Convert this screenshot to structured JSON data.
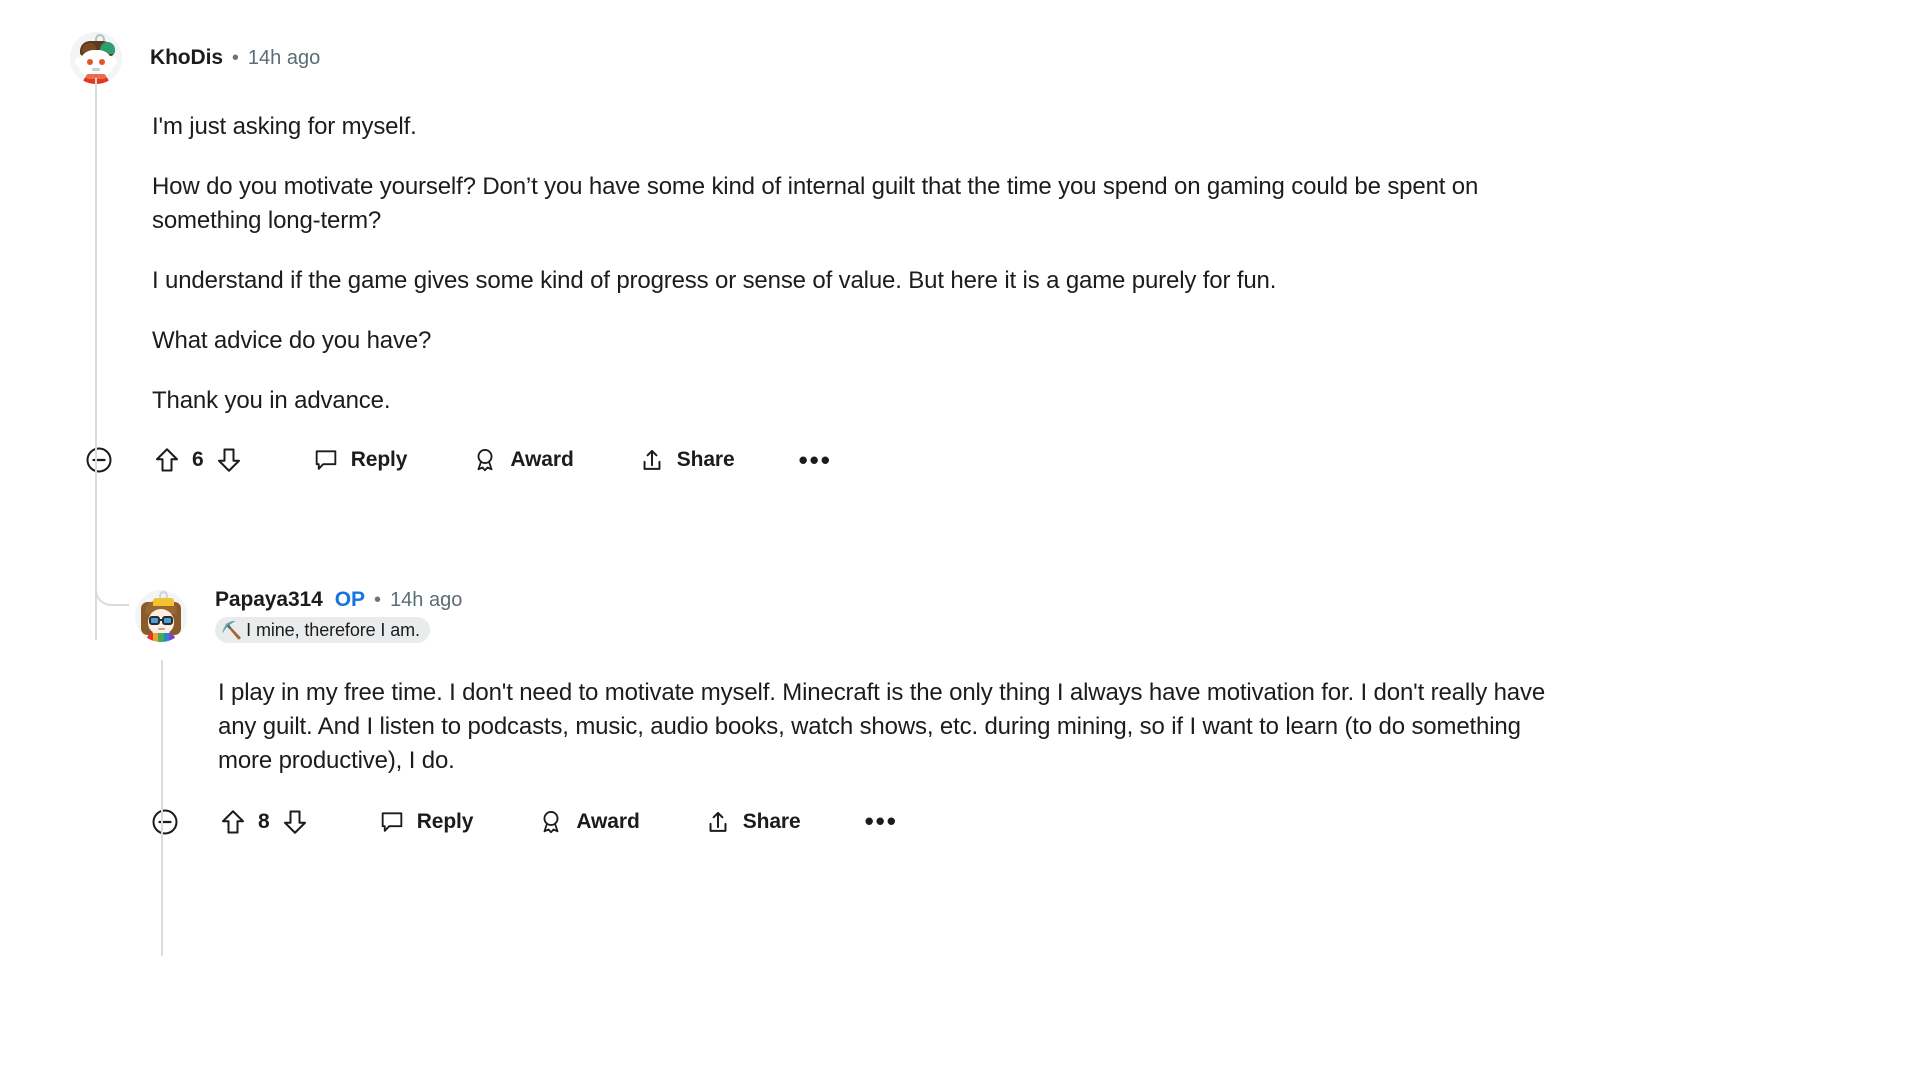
{
  "thread": {
    "comments": [
      {
        "id": "comment-khodis",
        "author": "KhoDis",
        "timestamp": "14h ago",
        "is_op": false,
        "op_label": "",
        "flair": null,
        "avatar_name": "snoo-avatar-khodis",
        "paragraphs": [
          "I'm just asking for myself.",
          "How do you motivate yourself? Don’t you have some kind of internal guilt that the time you spend on gaming could be spent on something long-term?",
          "I understand if the game gives some kind of progress or sense of value. But here it is a game purely for fun.",
          "What advice do you have?",
          "Thank you in advance."
        ],
        "actions": {
          "collapse_icon": "minus-circle-icon",
          "upvote_icon": "upvote-arrow-icon",
          "vote_count": "6",
          "downvote_icon": "downvote-arrow-icon",
          "reply_icon": "comment-bubble-icon",
          "reply_label": "Reply",
          "award_icon": "award-ribbon-icon",
          "award_label": "Award",
          "share_icon": "share-arrow-icon",
          "share_label": "Share",
          "more_label": "•••"
        }
      },
      {
        "id": "comment-papaya314",
        "author": "Papaya314",
        "timestamp": "14h ago",
        "is_op": true,
        "op_label": "OP",
        "flair": {
          "emoji": "⛏️",
          "emoji_name": "pickaxe-emoji",
          "text": "I mine, therefore I am."
        },
        "avatar_name": "snoo-avatar-papaya314",
        "paragraphs": [
          "I play in my free time. I don't need to motivate myself. Minecraft is the only thing I always have motivation for. I don't really have any guilt. And I listen to podcasts, music, audio books, watch shows, etc. during mining, so if I want to learn (to do something more productive), I do."
        ],
        "actions": {
          "collapse_icon": "minus-circle-icon",
          "upvote_icon": "upvote-arrow-icon",
          "vote_count": "8",
          "downvote_icon": "downvote-arrow-icon",
          "reply_icon": "comment-bubble-icon",
          "reply_label": "Reply",
          "award_icon": "award-ribbon-icon",
          "award_label": "Award",
          "share_icon": "share-arrow-icon",
          "share_label": "Share",
          "more_label": "•••"
        }
      }
    ]
  },
  "colors": {
    "text": "#1c1c1c",
    "meta": "#5c6c74",
    "op_blue": "#1874e0",
    "threadline": "#d9dcdf",
    "flair_bg": "#e9ebec",
    "background": "#ffffff"
  }
}
